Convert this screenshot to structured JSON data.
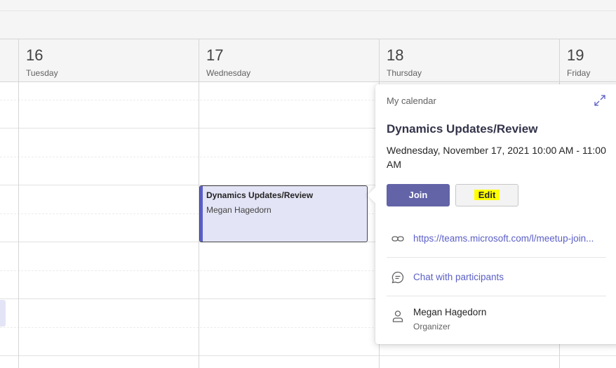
{
  "days": [
    {
      "number": "16",
      "name": "Tuesday"
    },
    {
      "number": "17",
      "name": "Wednesday"
    },
    {
      "number": "18",
      "name": "Thursday"
    },
    {
      "number": "19",
      "name": "Friday"
    }
  ],
  "event": {
    "title": "Dynamics Updates/Review",
    "organizer": "Megan Hagedorn",
    "accent_color": "#5b5fc7",
    "background_color": "#e3e4f5"
  },
  "popup": {
    "calendar_name": "My calendar",
    "title": "Dynamics Updates/Review",
    "time": "Wednesday, November 17, 2021 10:00 AM - 11:00 AM",
    "join_label": "Join",
    "edit_label": "Edit",
    "meeting_link": "https://teams.microsoft.com/l/meetup-join...",
    "chat_label": "Chat with participants",
    "organizer_name": "Megan Hagedorn",
    "organizer_role": "Organizer",
    "icons": {
      "expand": "expand-icon",
      "link": "link-icon",
      "chat": "chat-icon",
      "person": "person-icon"
    }
  }
}
